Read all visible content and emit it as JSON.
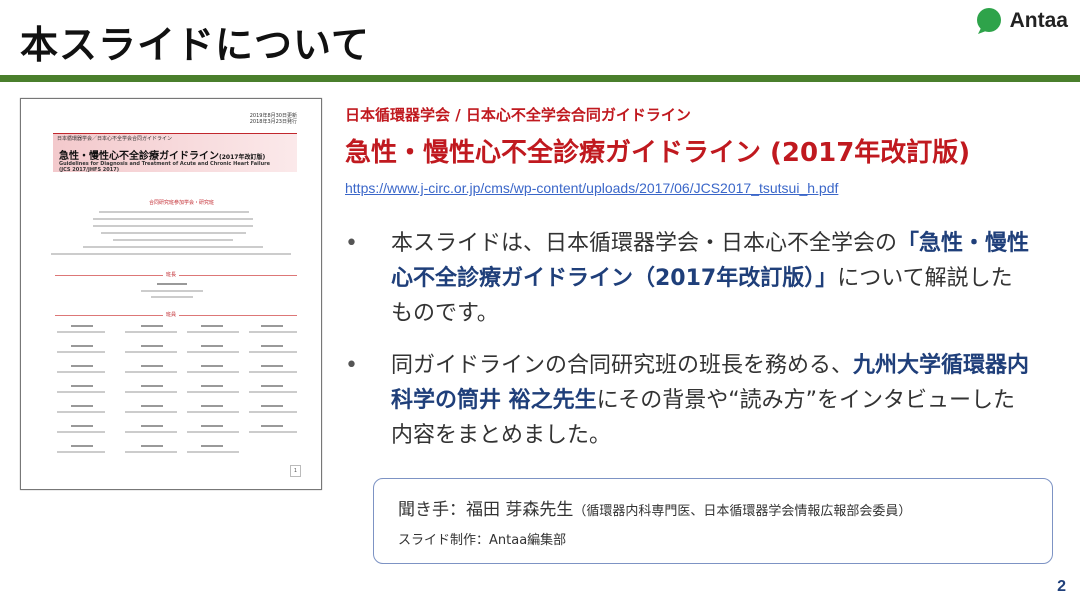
{
  "slide": {
    "title": "本スライドについて",
    "page_number": "2"
  },
  "brand": {
    "name": "Antaa",
    "icon": "antaa-logo-icon",
    "color": "#2ea34a"
  },
  "colors": {
    "accent_green": "#4a7f2c",
    "heading_red": "#c0191f",
    "emphasis_blue": "#1f3f7a",
    "link_blue": "#3b67c9"
  },
  "document_thumbnail": {
    "date_lines": [
      "2019年8月30日更新",
      "2018年3月23日発行"
    ],
    "society": "日本循環器学会／日本心不全学会合同ガイドライン",
    "title": "急性・慢性心不全診療ガイドライン",
    "title_suffix": "(2017年改訂版)",
    "english_title_lines": [
      "Guidelines for Diagnosis and Treatment of Acute and Chronic Heart Failure",
      "(JCS 2017/JHFS 2017)"
    ],
    "section_labels": [
      "合同研究班参加学会・研究班",
      "班長",
      "班員"
    ],
    "page": "1"
  },
  "guideline": {
    "subtitle": "日本循環器学会 / 日本心不全学会合同ガイドライン",
    "title": "急性・慢性心不全診療ガイドライン (2017年改訂版)",
    "url": "https://www.j-circ.or.jp/cms/wp-content/uploads/2017/06/JCS2017_tsutsui_h.pdf"
  },
  "bullets": {
    "b1_part1": "本スライドは、日本循環器学会・日本心不全学会の",
    "b1_bold": "「急性・慢性心不全診療ガイドライン（2017年改訂版）」",
    "b1_part2": "について解説したものです。",
    "b2_part1": "同ガイドラインの合同研究班の班長を務める、",
    "b2_bold": "九州大学循環器内科学の筒井 裕之先生",
    "b2_part2": "にその背景や“読み方”をインタビューした内容をまとめました。"
  },
  "interview": {
    "interviewer": "聞き手：福田 芽森先生",
    "interviewer_role": "（循環器内科専門医、日本循環器学会情報広報部会委員）",
    "credit": "スライド制作：Antaa編集部"
  }
}
